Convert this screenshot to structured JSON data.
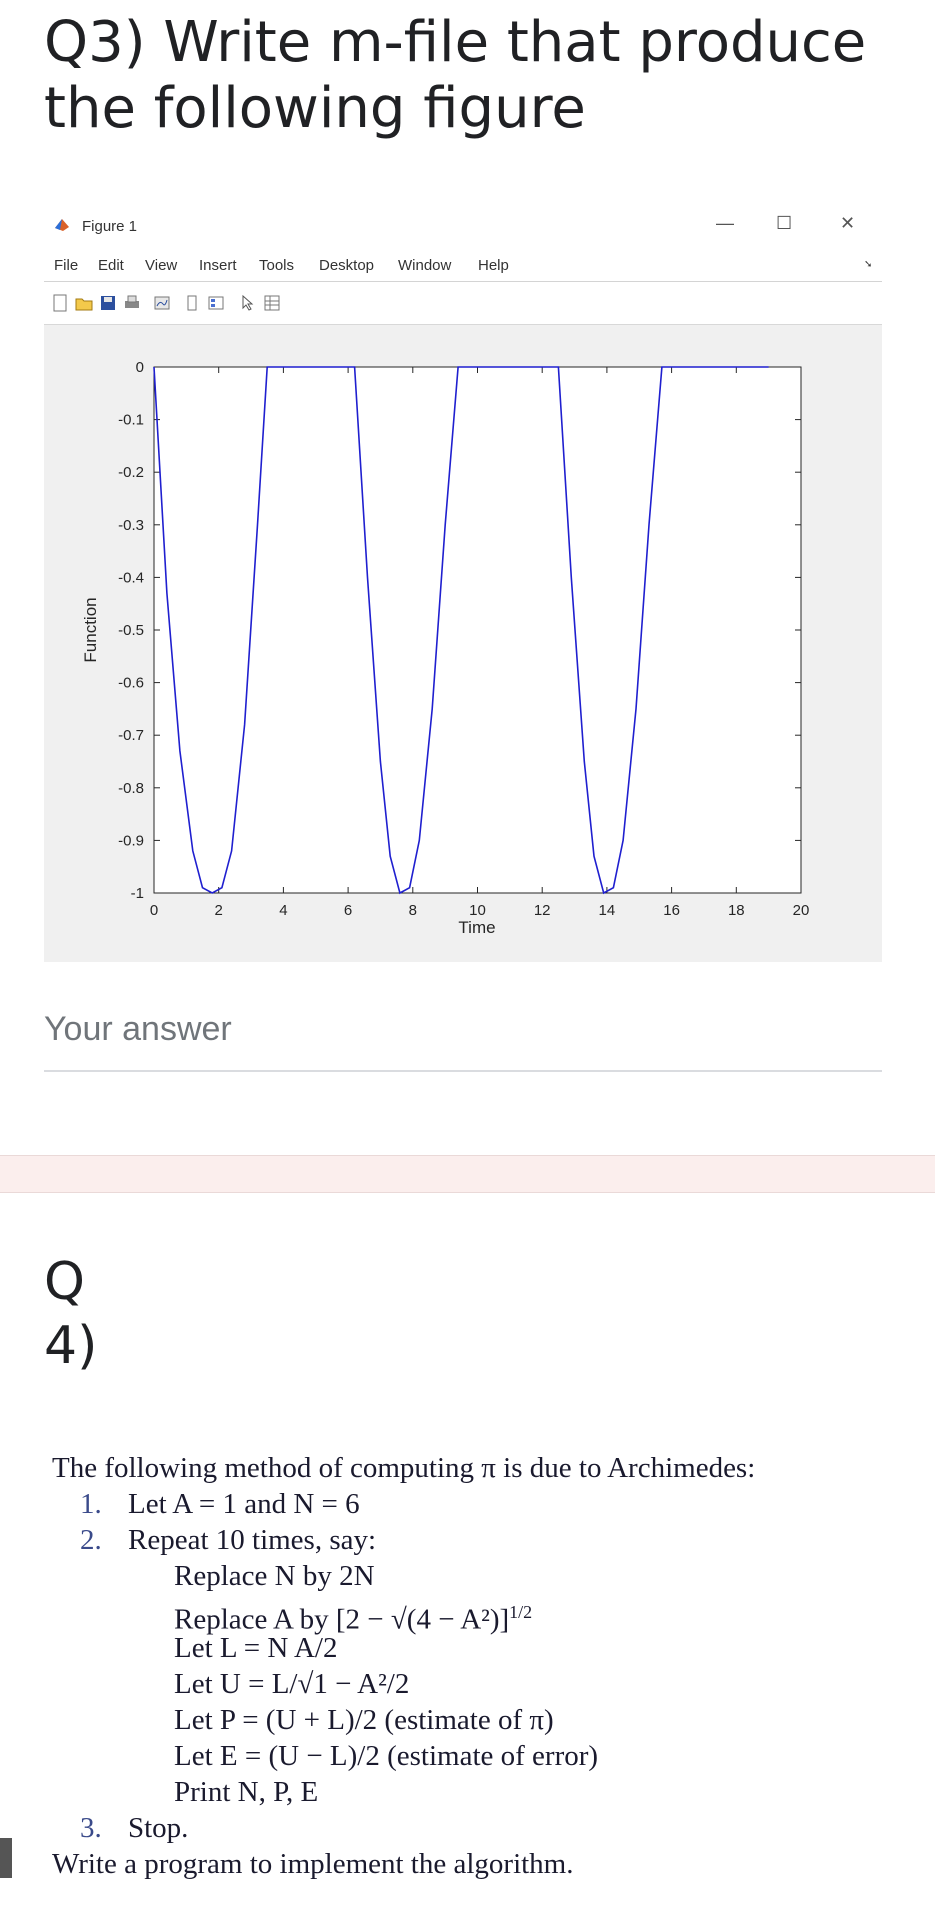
{
  "question3": {
    "title_line1": "Q3) Write m-file that produce",
    "title_line2": "the following figure"
  },
  "figure_window": {
    "title": "Figure 1",
    "controls": {
      "minimize": "—",
      "maximize": "☐",
      "close": "✕"
    },
    "menu": [
      "File",
      "Edit",
      "View",
      "Insert",
      "Tools",
      "Desktop",
      "Window",
      "Help"
    ],
    "toolbar_icons": [
      "new-figure-icon",
      "open-file-icon",
      "save-icon",
      "print-icon",
      "link-plot-icon",
      "colorbar-icon",
      "legend-icon",
      "pointer-icon",
      "property-editor-icon"
    ]
  },
  "chart_data": {
    "type": "line",
    "title": "",
    "xlabel": "Time",
    "ylabel": "Function",
    "xlim": [
      0,
      20
    ],
    "ylim": [
      -1,
      0
    ],
    "xticks": [
      0,
      2,
      4,
      6,
      8,
      10,
      12,
      14,
      16,
      18,
      20
    ],
    "yticks": [
      0,
      -0.1,
      -0.2,
      -0.3,
      -0.4,
      -0.5,
      -0.6,
      -0.7,
      -0.8,
      -0.9,
      -1
    ],
    "grid": false,
    "series": [
      {
        "color": "#1f1fcf",
        "x": [
          0,
          0.4,
          0.8,
          1.2,
          1.5,
          1.8,
          2.1,
          2.4,
          2.8,
          3.2,
          3.5,
          6.2,
          6.6,
          7.0,
          7.3,
          7.6,
          7.9,
          8.2,
          8.6,
          9.0,
          9.4,
          12.5,
          12.9,
          13.3,
          13.6,
          13.9,
          14.2,
          14.5,
          14.9,
          15.3,
          15.7,
          19.0
        ],
        "y": [
          0,
          -0.43,
          -0.73,
          -0.92,
          -0.99,
          -1.0,
          -0.99,
          -0.92,
          -0.68,
          -0.3,
          0,
          0,
          -0.4,
          -0.75,
          -0.93,
          -1.0,
          -0.99,
          -0.9,
          -0.65,
          -0.3,
          0,
          0,
          -0.4,
          -0.75,
          -0.93,
          -1.0,
          -0.99,
          -0.9,
          -0.65,
          -0.3,
          0,
          0
        ]
      }
    ]
  },
  "answer": {
    "placeholder": "Your answer"
  },
  "question4": {
    "title_line1": "Q",
    "title_line2": "4)",
    "intro": "The following method of computing π is due to Archimedes:",
    "step1_num": "1.",
    "step1": "Let A = 1 and N = 6",
    "step2_num": "2.",
    "step2": "Repeat 10 times, say:",
    "sub1": "Replace N by 2N",
    "sub2": "Replace A by [2 − √(4 − A²)]",
    "sub2_exp": "1/2",
    "sub3": "Let L = N A/2",
    "sub4": "Let U = L/√1 − A²/2",
    "sub5": "Let P = (U + L)/2 (estimate of π)",
    "sub6": "Let E = (U − L)/2 (estimate of error)",
    "sub7": "Print N, P, E",
    "step3_num": "3.",
    "step3": "Stop.",
    "closing": "Write a program to implement the algorithm."
  }
}
